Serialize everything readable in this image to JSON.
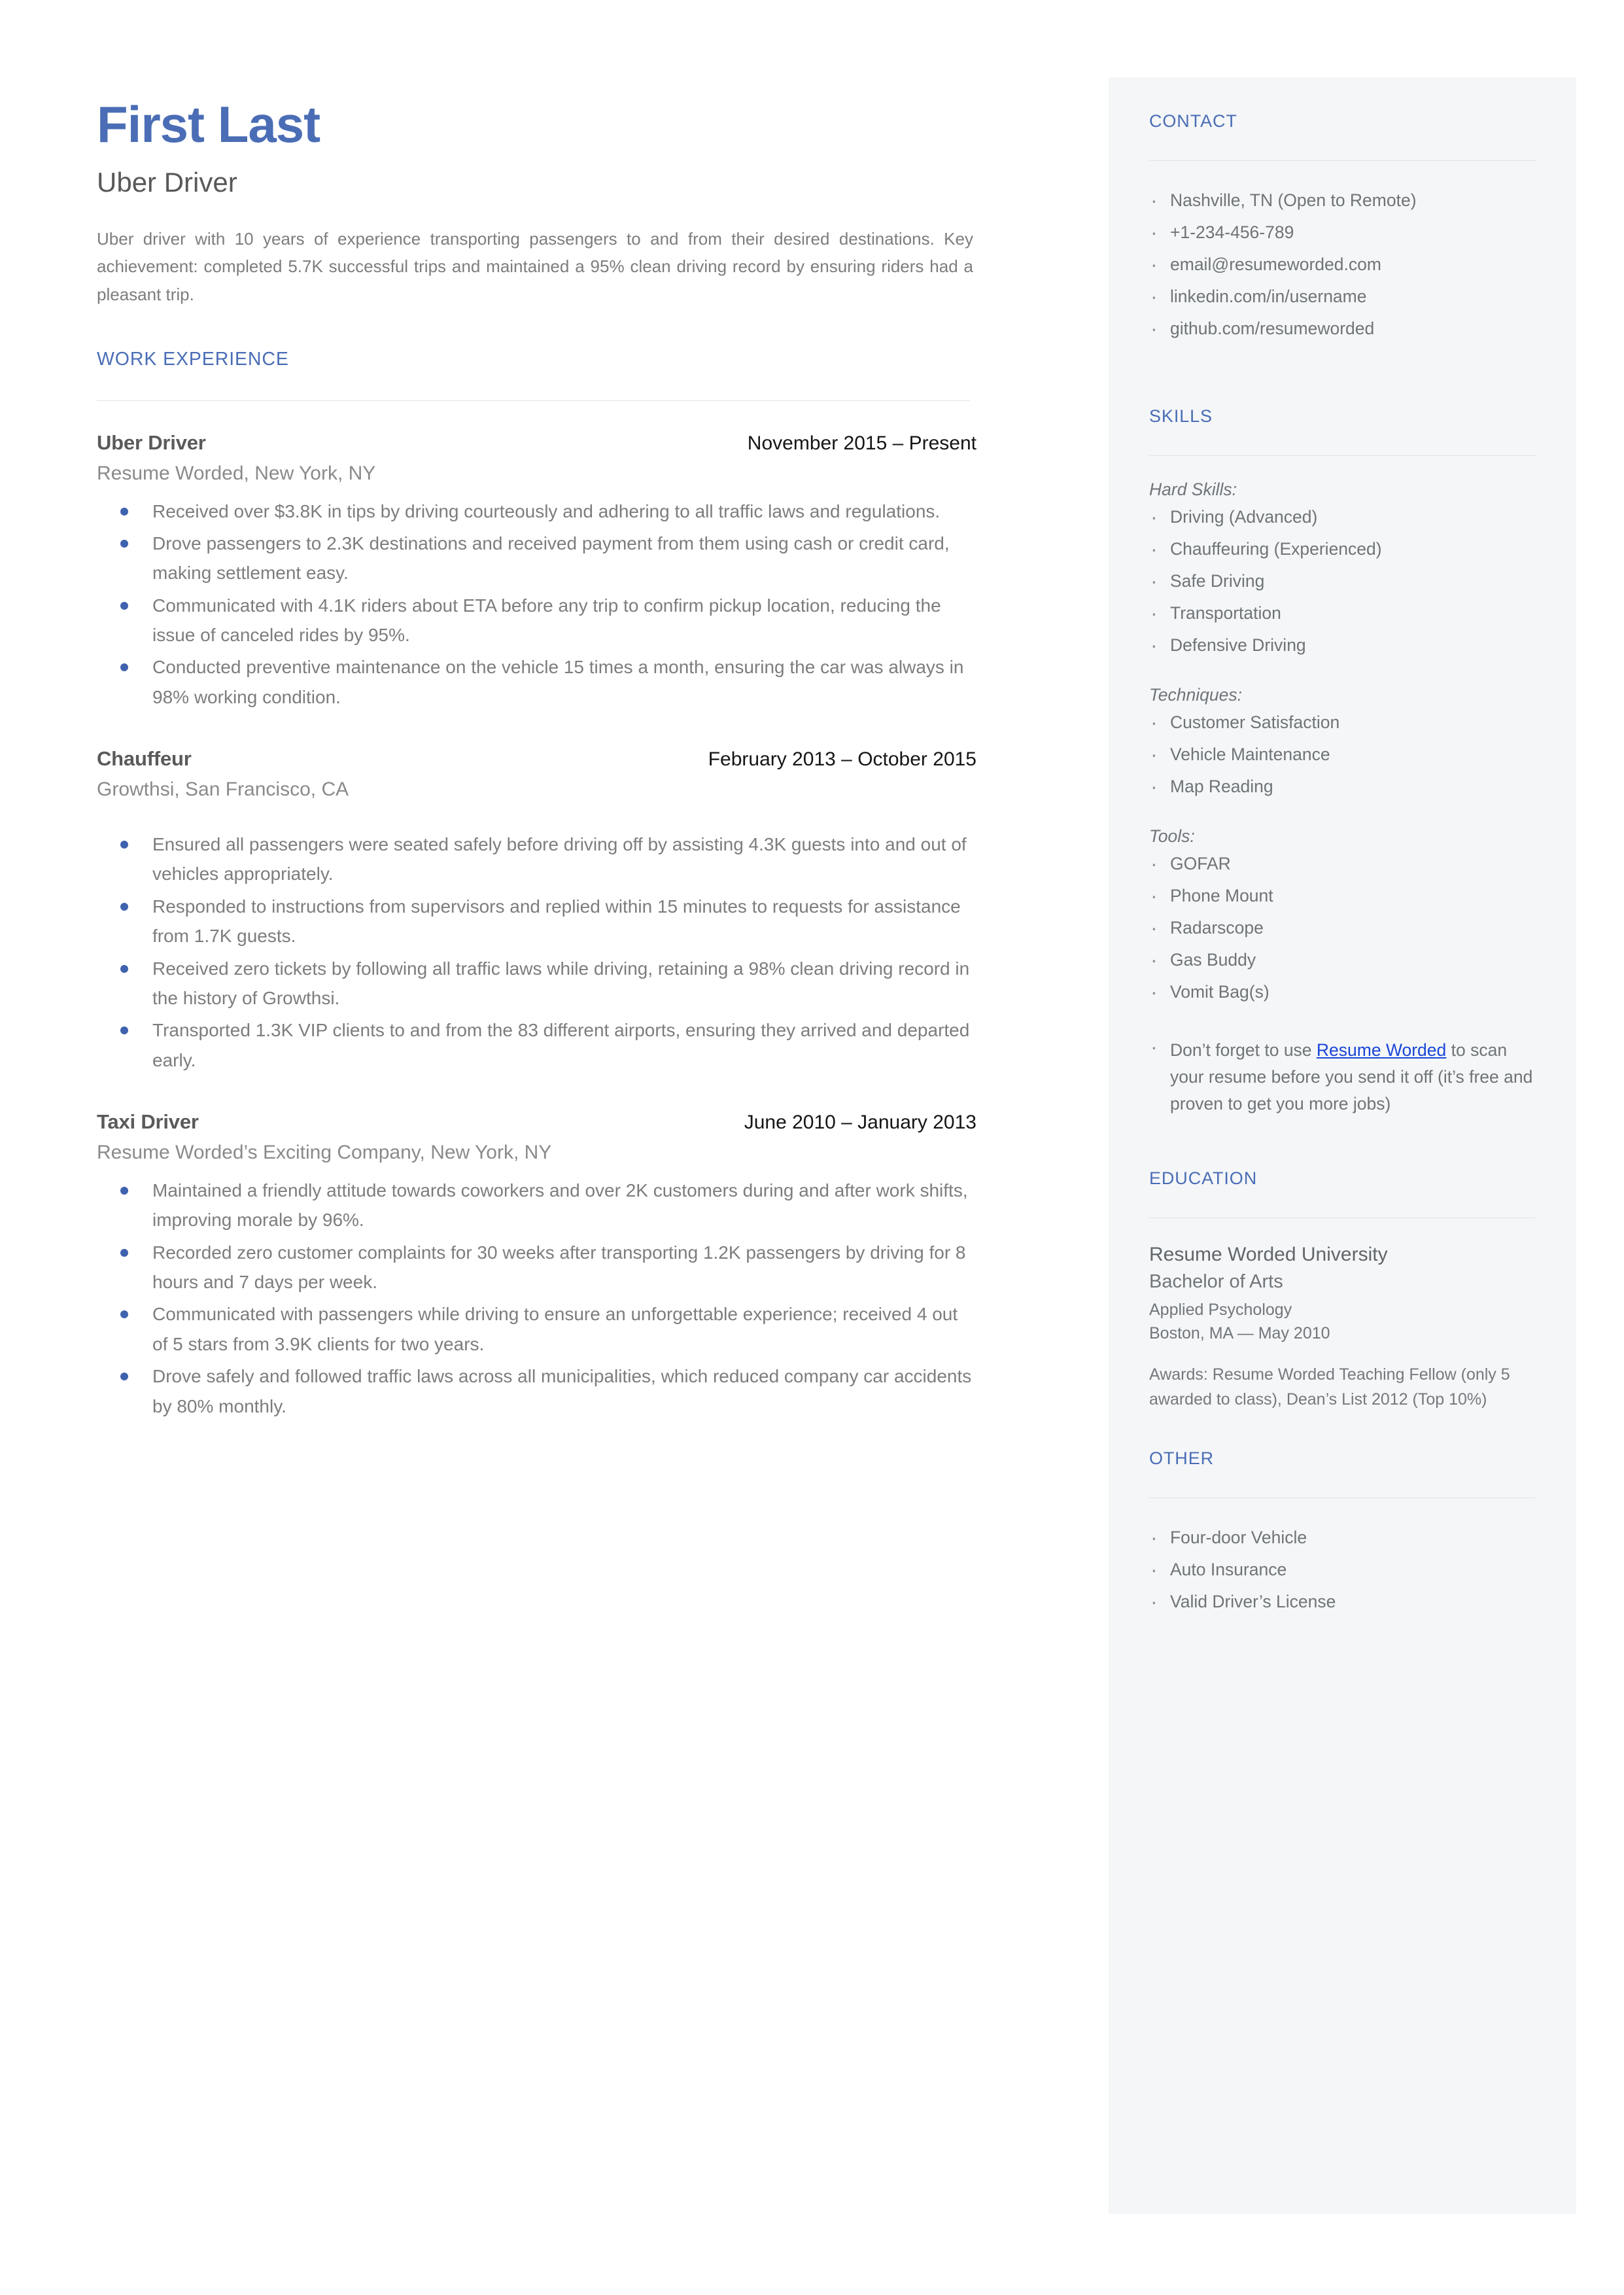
{
  "header": {
    "name": "First Last",
    "headline": "Uber Driver",
    "summary": "Uber driver with 10 years of experience transporting passengers to and from their desired destinations. Key achievement: completed 5.7K successful trips and maintained a 95% clean driving record by ensuring riders had a pleasant trip."
  },
  "work": {
    "section_title": "WORK EXPERIENCE",
    "jobs": [
      {
        "title": "Uber Driver",
        "dates": "November 2015 – Present",
        "company": "Resume Worded, New York, NY",
        "bullets": [
          "Received over $3.8K in tips by driving courteously and adhering to all traffic laws and regulations.",
          "Drove passengers to 2.3K destinations and received payment from them using cash or credit card, making settlement easy.",
          "Communicated with 4.1K riders about ETA before any trip to confirm pickup location, reducing the issue of canceled rides by 95%.",
          "Conducted preventive maintenance on the vehicle 15 times a month, ensuring the car was always in 98% working condition."
        ]
      },
      {
        "title": "Chauffeur",
        "dates": "February 2013 – October 2015",
        "company": "Growthsi, San Francisco, CA",
        "bullets": [
          "Ensured all passengers were seated safely before driving off by assisting 4.3K guests into and out of vehicles appropriately.",
          "Responded to instructions from supervisors and replied within 15 minutes to requests for assistance from 1.7K guests.",
          "Received zero tickets by following all traffic laws while driving, retaining a 98% clean driving record in the history of Growthsi.",
          "Transported 1.3K VIP clients to and from the 83 different airports, ensuring they arrived and departed early."
        ]
      },
      {
        "title": "Taxi Driver",
        "dates": "June 2010 – January 2013",
        "company": "Resume Worded’s Exciting Company, New York, NY",
        "bullets": [
          "Maintained a friendly attitude towards coworkers and over 2K customers during and after work shifts, improving morale by 96%.",
          "Recorded zero customer complaints for 30 weeks after transporting 1.2K passengers by driving for 8 hours and 7 days per week.",
          "Communicated with passengers while driving to ensure an unforgettable experience; received 4 out of 5 stars from 3.9K clients for two years.",
          "Drove safely and followed traffic laws across all municipalities, which reduced company car accidents by 80% monthly."
        ]
      }
    ]
  },
  "contact": {
    "section_title": "CONTACT",
    "items": [
      "Nashville, TN (Open to Remote)",
      "+1-234-456-789",
      "email@resumeworded.com",
      "linkedin.com/in/username",
      "github.com/resumeworded"
    ]
  },
  "skills": {
    "section_title": "SKILLS",
    "groups": [
      {
        "label": "Hard Skills:",
        "items": [
          "Driving (Advanced)",
          "Chauffeuring (Experienced)",
          "Safe Driving",
          "Transportation",
          "Defensive Driving"
        ]
      },
      {
        "label": "Techniques:",
        "items": [
          "Customer Satisfaction",
          "Vehicle Maintenance",
          "Map Reading"
        ]
      },
      {
        "label": "Tools:",
        "items": [
          "GOFAR",
          "Phone Mount",
          "Radarscope",
          "Gas Buddy",
          "Vomit Bag(s)"
        ]
      }
    ],
    "promo_prefix": "Don’t forget to use ",
    "promo_link": "Resume Worded",
    "promo_suffix": " to scan your resume before you send it off (it’s free and proven to get you more jobs)"
  },
  "education": {
    "section_title": "EDUCATION",
    "school": "Resume Worded University",
    "degree": "Bachelor of Arts",
    "field": "Applied Psychology",
    "location_date": "Boston, MA — May 2010",
    "awards": "Awards: Resume Worded Teaching Fellow (only 5 awarded to class), Dean’s List 2012 (Top 10%)"
  },
  "other": {
    "section_title": "OTHER",
    "items": [
      "Four-door Vehicle",
      "Auto Insurance",
      "Valid Driver’s License"
    ]
  },
  "colors": {
    "accent_blue": "#4a6db5",
    "bullet_blue": "#3f62ae",
    "link_blue": "#1a46d6",
    "sidebar_bg": "#f4f6f8",
    "body_gray": "#7d7d7d"
  }
}
